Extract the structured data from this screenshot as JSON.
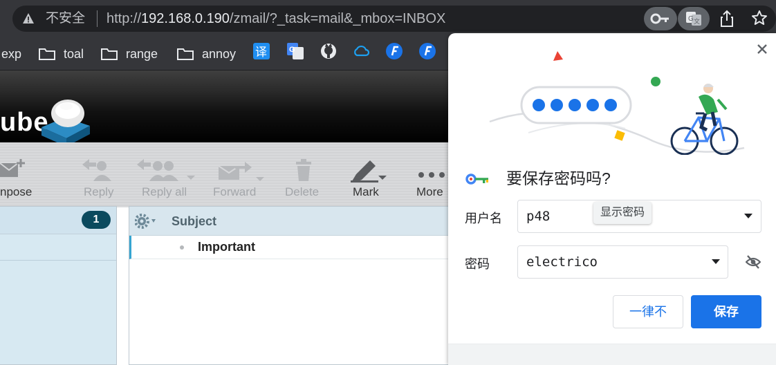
{
  "browser": {
    "security_label": "不安全",
    "url_prefix": "http://",
    "url_host": "192.168.0.190",
    "url_path": "/zmail/?_task=mail&_mbox=INBOX",
    "toolbar_icons": [
      "warning-icon",
      "key-icon",
      "translate-icon",
      "share-icon",
      "star-icon"
    ]
  },
  "bookmarks": {
    "items": [
      {
        "label": "exp",
        "icon": "none"
      },
      {
        "label": "toal",
        "icon": "folder-icon"
      },
      {
        "label": "range",
        "icon": "folder-icon"
      },
      {
        "label": "annoy",
        "icon": "folder-icon"
      }
    ],
    "icons": [
      "translate-yi-icon",
      "google-translate-icon",
      "github-icon",
      "cloud-icon",
      "fast-icon",
      "fast-icon"
    ],
    "yi_glyph": "译"
  },
  "roundcube": {
    "logo_text": "ube",
    "toolbar": [
      {
        "label": "npose",
        "icon": "compose-icon"
      },
      {
        "label": "Reply",
        "icon": "reply-icon"
      },
      {
        "label": "Reply all",
        "icon": "reply-all-icon"
      },
      {
        "label": "Forward",
        "icon": "forward-icon"
      },
      {
        "label": "Delete",
        "icon": "trash-icon"
      },
      {
        "label": "Mark",
        "icon": "mark-icon"
      },
      {
        "label": "More",
        "icon": "more-icon"
      }
    ],
    "unread_count": "1",
    "list_header": {
      "subject": "Subject"
    },
    "messages": [
      {
        "subject": "Important"
      }
    ]
  },
  "password_popup": {
    "title": "要保存密码吗?",
    "username_label": "用户名",
    "username_value": "p48",
    "password_label": "密码",
    "password_value": "electrico",
    "tooltip": "显示密码",
    "never_button": "一律不",
    "save_button": "保存",
    "colors": {
      "accent": "#1a73e8",
      "primary_text": "#202124"
    }
  }
}
